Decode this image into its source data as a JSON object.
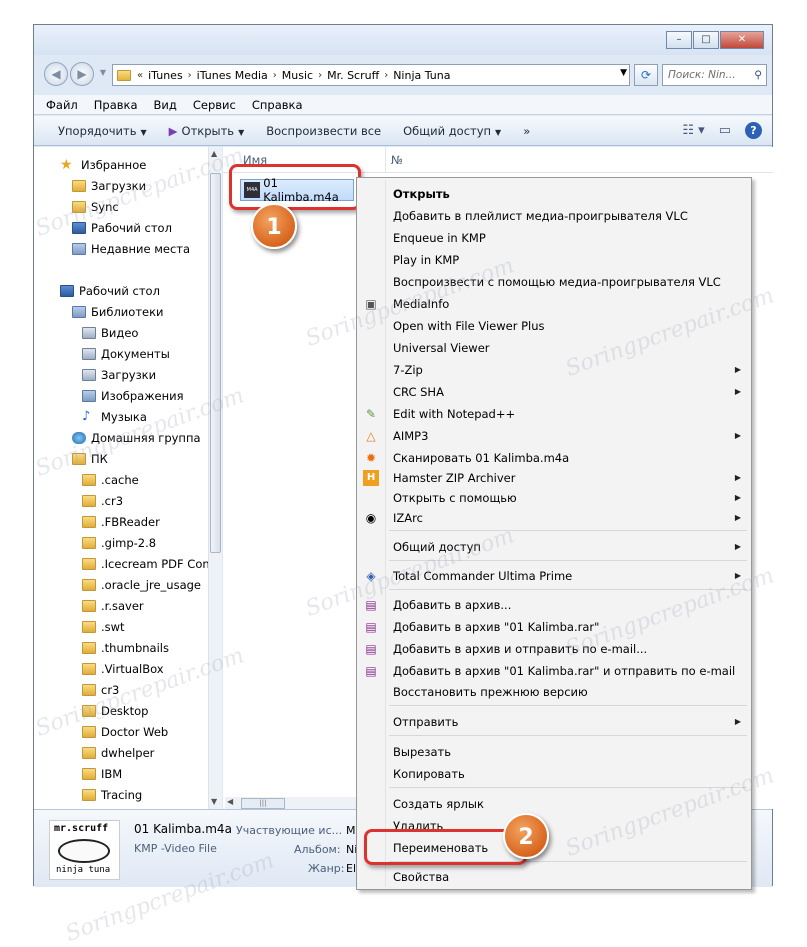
{
  "window": {
    "minimize": "–",
    "maximize": "□",
    "close": "✕"
  },
  "address": {
    "separator": "›",
    "prefix": "«",
    "crumbs": [
      "iTunes",
      "iTunes Media",
      "Music",
      "Mr. Scruff",
      "Ninja Tuna"
    ],
    "search_placeholder": "Поиск: Nin..."
  },
  "menu": [
    "Файл",
    "Правка",
    "Вид",
    "Сервис",
    "Справка"
  ],
  "toolbar": {
    "organize": "Упорядочить",
    "open": "Открыть",
    "play_all": "Воспроизвести все",
    "share": "Общий доступ",
    "more": "»"
  },
  "nav": {
    "favorites": "Избранное",
    "downloads": "Загрузки",
    "sync": "Sync",
    "desktop": "Рабочий стол",
    "recent": "Недавние места",
    "desktop2": "Рабочий стол",
    "libraries": "Библиотеки",
    "video": "Видео",
    "documents": "Документы",
    "downloads2": "Загрузки",
    "images": "Изображения",
    "music": "Музыка",
    "homegroup": "Домашняя группа",
    "pc": "ПК",
    "folders": [
      ".cache",
      ".cr3",
      ".FBReader",
      ".gimp-2.8",
      ".Icecream PDF Conv",
      ".oracle_jre_usage",
      ".r.saver",
      ".swt",
      ".thumbnails",
      ".VirtualBox",
      "cr3",
      "Desktop",
      "Doctor Web",
      "dwhelper",
      "IBM",
      "Tracing"
    ]
  },
  "content": {
    "col_name": "Имя",
    "col_num": "№",
    "file_name": "01 Kalimba.m4a"
  },
  "details": {
    "file_name": "01 Kalimba.m4a",
    "file_type": "KMP -Video File",
    "artists_label": "Участвующие ис...",
    "artists_value": "M",
    "album_label": "Альбом:",
    "album_value": "Ni",
    "genre_label": "Жанр:",
    "genre_value": "El",
    "art_top": "mr.scruff",
    "art_bottom": "ninja tuna"
  },
  "context_menu": {
    "items": [
      {
        "label": "Открыть",
        "bold": true
      },
      {
        "label": "Добавить в плейлист медиа-проигрывателя VLC"
      },
      {
        "label": "Enqueue in KMP"
      },
      {
        "label": "Play in KMP"
      },
      {
        "label": "Воспроизвести с помощью медиа-проигрывателя VLC"
      },
      {
        "label": "MediaInfo"
      },
      {
        "label": "Open with File Viewer Plus"
      },
      {
        "label": "Universal Viewer"
      },
      {
        "label": "7-Zip"
      },
      {
        "label": "CRC SHA"
      },
      {
        "label": "Edit with Notepad++"
      },
      {
        "label": "AIMP3"
      },
      {
        "label": "Сканировать 01 Kalimba.m4a"
      },
      {
        "label": "Hamster ZIP Archiver"
      },
      {
        "label": "Открыть с помощью"
      },
      {
        "label": "IZArc"
      },
      {
        "label": "Общий доступ"
      },
      {
        "label": "Total Commander Ultima Prime"
      },
      {
        "label": "Добавить в архив..."
      },
      {
        "label": "Добавить в архив \"01 Kalimba.rar\""
      },
      {
        "label": "Добавить в архив и отправить по e-mail..."
      },
      {
        "label": "Добавить в архив \"01 Kalimba.rar\" и отправить по e-mail"
      },
      {
        "label": "Восстановить прежнюю версию"
      },
      {
        "label": "Отправить"
      },
      {
        "label": "Вырезать"
      },
      {
        "label": "Копировать"
      },
      {
        "label": "Создать ярлык"
      },
      {
        "label": "Удалить"
      },
      {
        "label": "Переименовать"
      },
      {
        "label": "Свойства"
      }
    ]
  },
  "annotations": {
    "step1": "1",
    "step2": "2",
    "accent": "#dc3330",
    "badge_color": "#d8651f"
  },
  "watermark": "Soringpcrepair.com"
}
